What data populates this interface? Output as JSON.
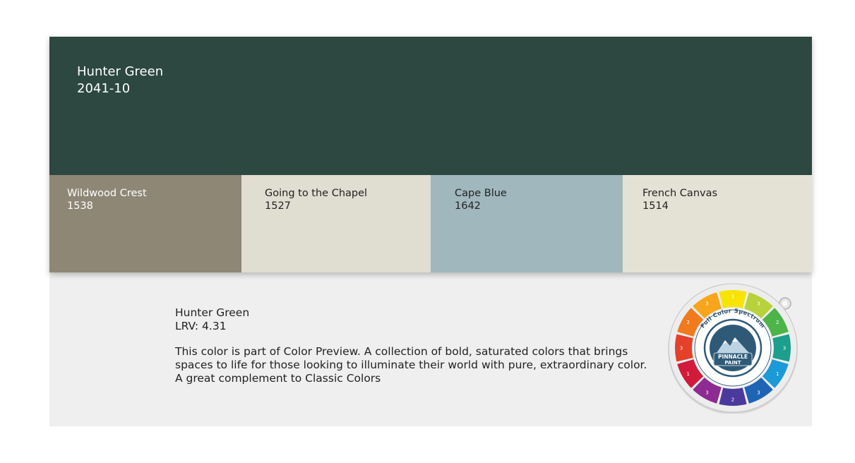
{
  "main_color": {
    "name": "Hunter Green",
    "code": "2041-10",
    "hex": "#2c4840"
  },
  "coordinating_colors": [
    {
      "name": "Wildwood Crest",
      "code": "1538",
      "hex": "#8e8776",
      "text_color": "#ffffff"
    },
    {
      "name": "Going to the Chapel",
      "code": "1527",
      "hex": "#e0ded1",
      "text_color": "#222222"
    },
    {
      "name": "Cape Blue",
      "code": "1642",
      "hex": "#a0b8bd",
      "text_color": "#222222"
    },
    {
      "name": "French Canvas",
      "code": "1514",
      "hex": "#e4e2d5",
      "text_color": "#222222"
    }
  ],
  "details": {
    "name": "Hunter Green",
    "lrv": "LRV: 4.31",
    "description_lines": [
      "This color is part of Color Preview. A collection of bold, saturated colors that brings",
      "spaces to life for those looking to illuminate their world with pure, extraordinary color.",
      "A great complement to Classic Colors"
    ]
  },
  "color_wheel": {
    "ring_title": "Full Color Spectrum",
    "logo_line1": "PINNACLE",
    "logo_line2": "PAINT",
    "segments": [
      {
        "color": "#f7e400",
        "label": "1"
      },
      {
        "color": "#b7d23a",
        "label": "3"
      },
      {
        "color": "#4cb448",
        "label": "2"
      },
      {
        "color": "#1c9f8c",
        "label": "3"
      },
      {
        "color": "#1c9ad8",
        "label": "1"
      },
      {
        "color": "#1e64b4",
        "label": "3"
      },
      {
        "color": "#4b3a9c",
        "label": "2"
      },
      {
        "color": "#8e2b92",
        "label": "3"
      },
      {
        "color": "#d21a3a",
        "label": "1"
      },
      {
        "color": "#e4402a",
        "label": "3"
      },
      {
        "color": "#f17a1e",
        "label": "2"
      },
      {
        "color": "#f8a51b",
        "label": "3"
      }
    ]
  }
}
